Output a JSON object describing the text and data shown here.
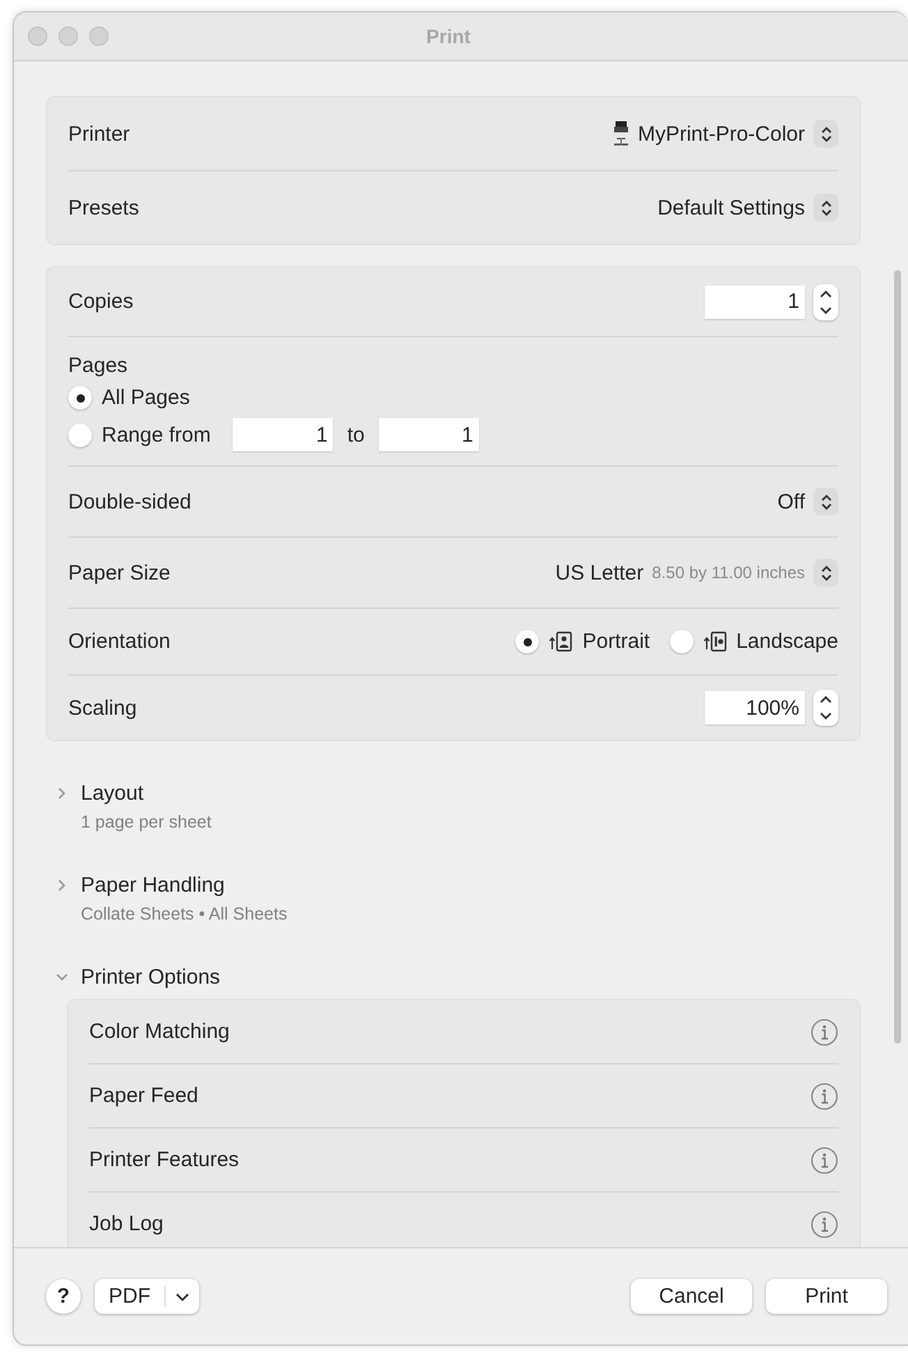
{
  "window": {
    "title": "Print"
  },
  "printer": {
    "label": "Printer",
    "value": "MyPrint-Pro-Color"
  },
  "presets": {
    "label": "Presets",
    "value": "Default Settings"
  },
  "copies": {
    "label": "Copies",
    "value": "1"
  },
  "pages": {
    "label": "Pages",
    "options": [
      {
        "label": "All Pages",
        "selected": true
      },
      {
        "label": "Range from",
        "selected": false
      }
    ],
    "from": "1",
    "to_label": "to",
    "to": "1"
  },
  "double_sided": {
    "label": "Double-sided",
    "value": "Off"
  },
  "paper_size": {
    "label": "Paper Size",
    "value": "US Letter",
    "detail": "8.50 by 11.00 inches"
  },
  "orientation": {
    "label": "Orientation",
    "options": [
      {
        "label": "Portrait",
        "kind": "portrait",
        "selected": true
      },
      {
        "label": "Landscape",
        "kind": "landscape",
        "selected": false
      }
    ]
  },
  "scaling": {
    "label": "Scaling",
    "value": "100%"
  },
  "sections": [
    {
      "title": "Layout",
      "summary": "1 page per sheet",
      "expanded": false
    },
    {
      "title": "Paper Handling",
      "summary": "Collate Sheets • All Sheets",
      "expanded": false
    },
    {
      "title": "Printer Options",
      "expanded": true,
      "items": [
        "Color Matching",
        "Paper Feed",
        "Printer Features",
        "Job Log"
      ]
    }
  ],
  "footer": {
    "help": "?",
    "pdf": "PDF",
    "buttons": [
      "Cancel",
      "Print"
    ]
  }
}
